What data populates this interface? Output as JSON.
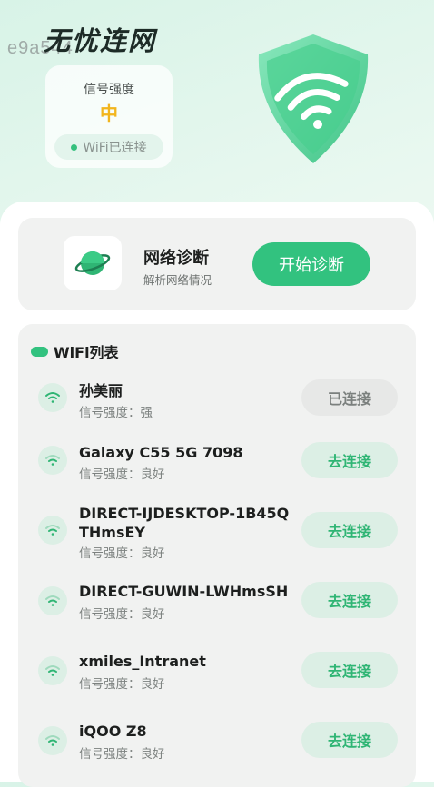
{
  "watermark": "e9a544",
  "app_title": "无忧连网",
  "signal_card": {
    "label": "信号强度",
    "value": "中",
    "status": "WiFi已连接"
  },
  "diagnosis": {
    "title": "网络诊断",
    "subtitle": "解析网络情况",
    "button": "开始诊断"
  },
  "wifi_list": {
    "title": "WiFi列表",
    "networks": [
      {
        "name": "孙美丽",
        "strength": "信号强度：强",
        "action": "已连接"
      },
      {
        "name": "Galaxy C55 5G 7098",
        "strength": "信号强度：良好",
        "action": "去连接"
      },
      {
        "name": "DIRECT-IJDESKTOP-1B45QTHmsEY",
        "strength": "信号强度：良好",
        "action": "去连接"
      },
      {
        "name": "DIRECT-GUWIN-LWHmsSH",
        "strength": "信号强度：良好",
        "action": "去连接"
      },
      {
        "name": "xmiles_Intranet",
        "strength": "信号强度：良好",
        "action": "去连接"
      },
      {
        "name": "iQOO Z8",
        "strength": "信号强度：良好",
        "action": "去连接"
      }
    ]
  },
  "icons": {
    "shield": "wifi-shield-icon",
    "diagnosis": "planet-icon",
    "wifi": "wifi-icon"
  },
  "colors": {
    "accent": "#32c27f",
    "signal_medium": "#f2b51d"
  }
}
